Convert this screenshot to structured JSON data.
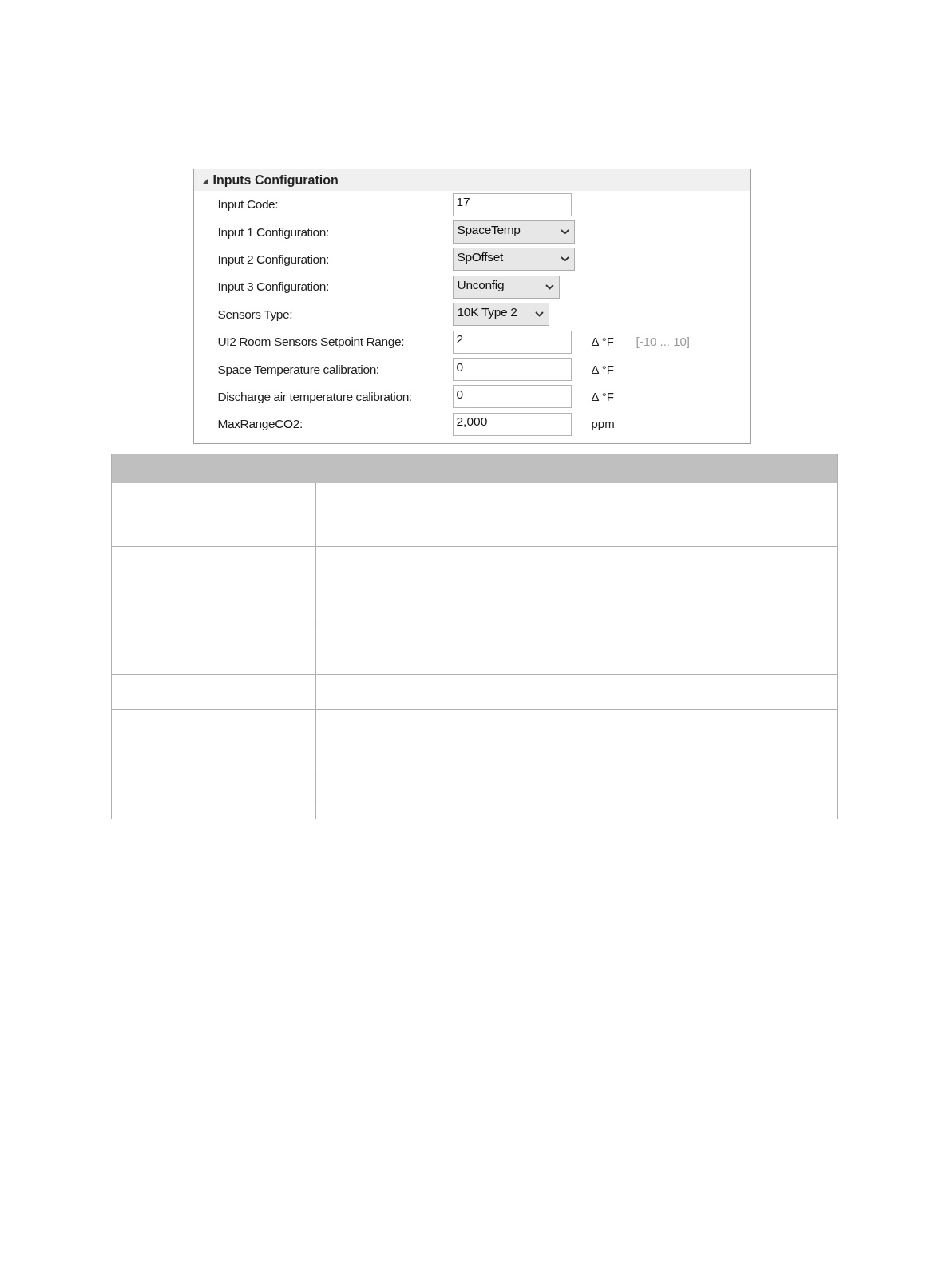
{
  "panel": {
    "title": "Inputs Configuration",
    "expanded": true,
    "rows": [
      {
        "label": "Input Code:",
        "kind": "text",
        "value": "17"
      },
      {
        "label": "Input 1 Configuration:",
        "kind": "select",
        "value": "SpaceTemp"
      },
      {
        "label": "Input 2 Configuration:",
        "kind": "select",
        "value": "SpOffset"
      },
      {
        "label": "Input 3 Configuration:",
        "kind": "select",
        "value": "Unconfig"
      },
      {
        "label": "Sensors Type:",
        "kind": "select",
        "value": "10K Type 2"
      },
      {
        "label": "UI2  Room Sensors Setpoint Range:",
        "kind": "text",
        "value": "2",
        "unit": "Δ °F",
        "range": "[-10 ... 10]"
      },
      {
        "label": "Space Temperature calibration:",
        "kind": "text",
        "value": "0",
        "unit": "Δ °F"
      },
      {
        "label": "Discharge air temperature calibration:",
        "kind": "text",
        "value": "0",
        "unit": "Δ °F"
      },
      {
        "label": "MaxRangeCO2:",
        "kind": "text",
        "value": "2,000",
        "unit": "ppm"
      }
    ]
  }
}
